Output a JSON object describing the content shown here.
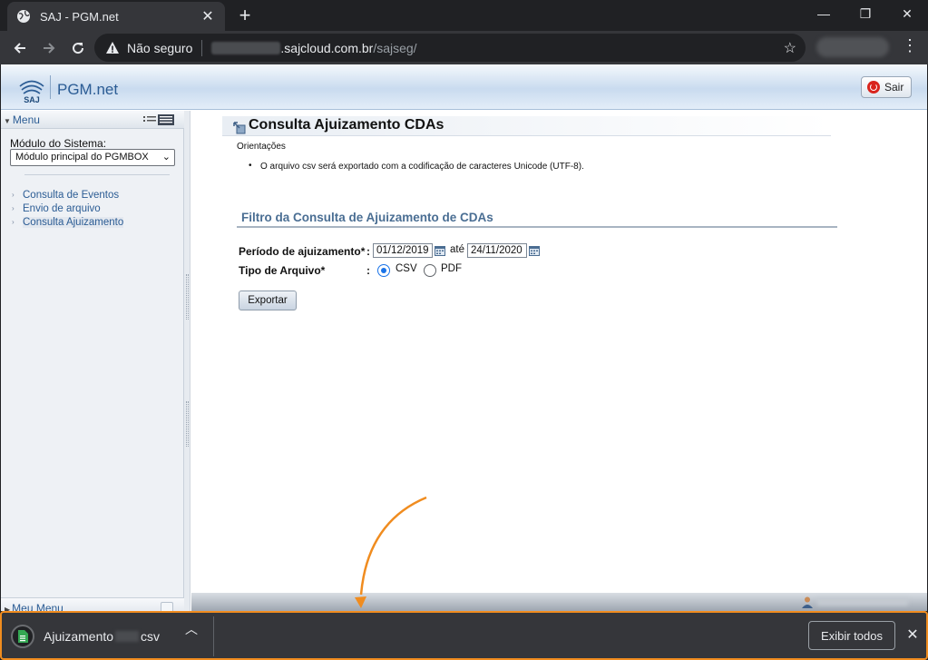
{
  "browser": {
    "tab_title": "SAJ - PGM.net",
    "tab_close": "✕",
    "new_tab": "+",
    "security_label": "Não seguro",
    "url_host": ".sajcloud.com.br",
    "url_path": "/sajseg/",
    "minimize": "—",
    "restore": "❐",
    "close": "✕"
  },
  "app": {
    "logo_text": "SAJ",
    "name": "PGM.net",
    "logout_label": "Sair"
  },
  "sidebar": {
    "menu_label": "Menu",
    "module_label": "Módulo do Sistema:",
    "module_selected": "Módulo principal do PGMBOX",
    "links": [
      {
        "label": "Consulta de Eventos"
      },
      {
        "label": "Envio de arquivo"
      },
      {
        "label": "Consulta Ajuizamento"
      }
    ],
    "my_menu_label": "Meu Menu",
    "search_placeholder": ""
  },
  "content": {
    "title": "Consulta Ajuizamento CDAs",
    "guidance_label": "Orientações",
    "guidance_item": "O arquivo csv será exportado com a codificação de caracteres Unicode (UTF-8).",
    "filter_title": "Filtro da Consulta de Ajuizamento de CDAs",
    "period_label": "Período de ajuizamento*",
    "colon": ":",
    "date_from": "01/12/2019",
    "date_between": "até",
    "date_to": "24/11/2020",
    "file_type_label": "Tipo de Arquivo*",
    "options": [
      {
        "label": "CSV",
        "checked": true
      },
      {
        "label": "PDF",
        "checked": false
      }
    ],
    "export_button": "Exportar"
  },
  "downloads": {
    "file_prefix": "Ajuizamento",
    "file_ext": "csv",
    "show_all": "Exibir todos",
    "close": "✕"
  },
  "colors": {
    "highlight": "#f08c1f",
    "link": "#2b5c94",
    "radio_checked": "#1a73e8"
  }
}
